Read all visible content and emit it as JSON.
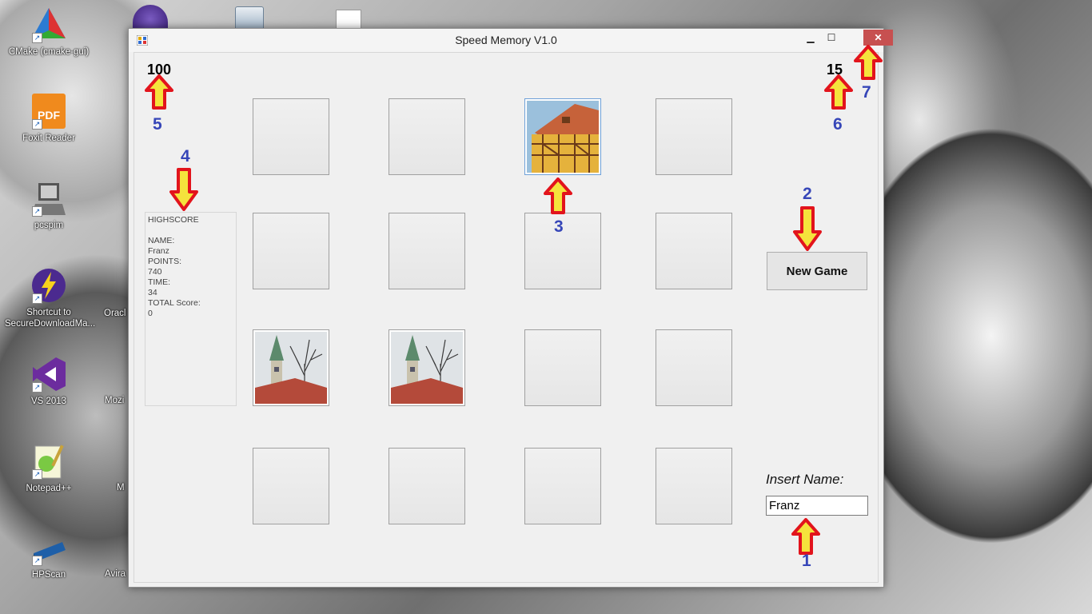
{
  "desktop": {
    "icons": [
      {
        "label": "CMake (cmake-gui)"
      },
      {
        "label": "Foxit Reader"
      },
      {
        "label": "pcspim"
      },
      {
        "label": "Shortcut to SecureDownloadMa..."
      },
      {
        "label": "VS 2013"
      },
      {
        "label": "Notepad++"
      },
      {
        "label": "HPScan"
      }
    ],
    "partial_labels": [
      "Oracl",
      "Mozi",
      "M",
      "Avira"
    ]
  },
  "window": {
    "title": "Speed Memory V1.0",
    "controls": {
      "minimize": "▁",
      "maximize": "☐",
      "close": "✕"
    }
  },
  "game": {
    "score_left": "100",
    "score_right": "15",
    "highscore": {
      "heading": "HIGHSCORE",
      "name_label": "NAME:",
      "name_value": "Franz",
      "points_label": "POINTS:",
      "points_value": "740",
      "time_label": "TIME:",
      "time_value": "34",
      "total_label": "TOTAL Score:",
      "total_value": "0"
    },
    "new_game_label": "New Game",
    "insert_name_label": "Insert Name:",
    "name_input_value": "Franz"
  },
  "annotations": [
    "1",
    "2",
    "3",
    "4",
    "5",
    "6",
    "7"
  ],
  "colors": {
    "arrow_fill": "#f5e33c",
    "arrow_stroke": "#e2141c",
    "number": "#3646b8",
    "close_button": "#c75050"
  }
}
